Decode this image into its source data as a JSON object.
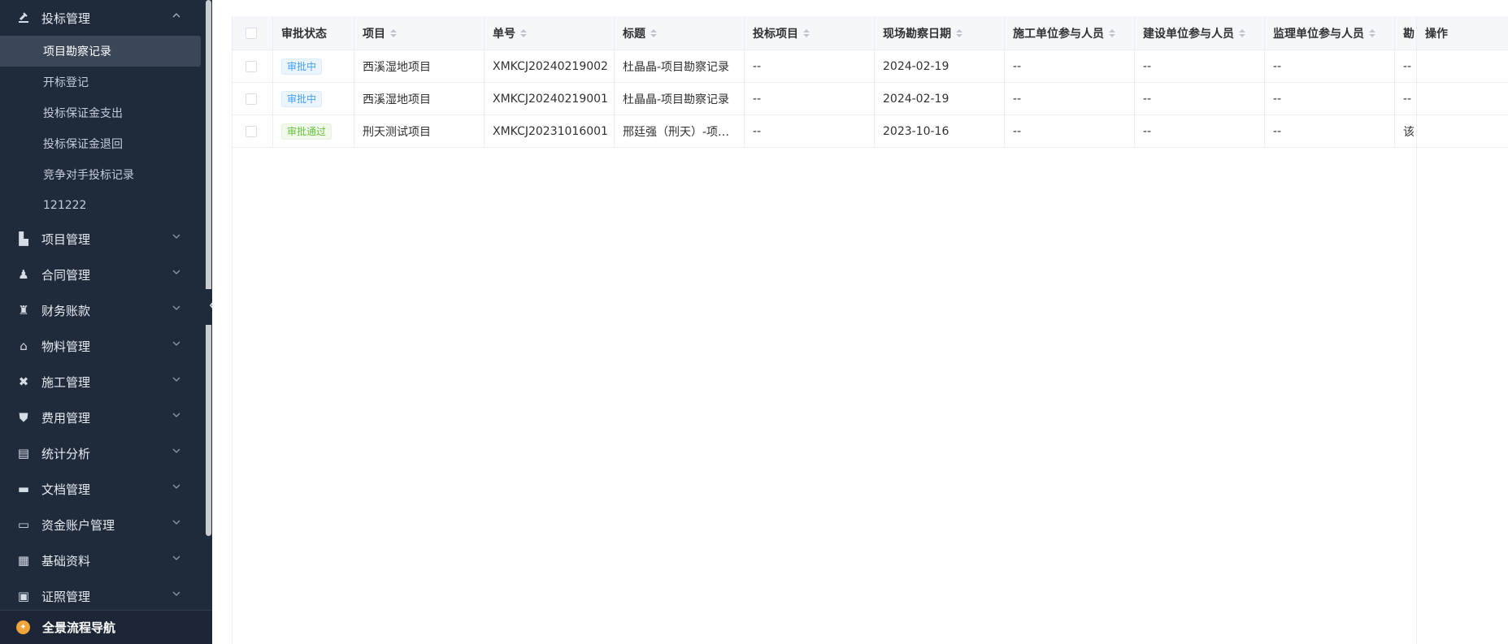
{
  "sidebar": {
    "open_group": {
      "label": "投标管理",
      "icon": "gavel-icon"
    },
    "submenu": [
      {
        "label": "项目勘察记录",
        "active": true
      },
      {
        "label": "开标登记",
        "active": false
      },
      {
        "label": "投标保证金支出",
        "active": false
      },
      {
        "label": "投标保证金退回",
        "active": false
      },
      {
        "label": "竞争对手投标记录",
        "active": false
      },
      {
        "label": "121222",
        "active": false
      }
    ],
    "groups": [
      {
        "label": "项目管理",
        "icon": "building-icon",
        "glyph": "▙"
      },
      {
        "label": "合同管理",
        "icon": "user-stamp-icon",
        "glyph": "♟"
      },
      {
        "label": "财务账款",
        "icon": "money-bag-icon",
        "glyph": "♜"
      },
      {
        "label": "物料管理",
        "icon": "warehouse-icon",
        "glyph": "⌂"
      },
      {
        "label": "施工管理",
        "icon": "tools-icon",
        "glyph": "✖"
      },
      {
        "label": "费用管理",
        "icon": "shield-icon",
        "glyph": "⛊"
      },
      {
        "label": "统计分析",
        "icon": "chart-icon",
        "glyph": "▤"
      },
      {
        "label": "文档管理",
        "icon": "folder-icon",
        "glyph": "▬"
      },
      {
        "label": "资金账户管理",
        "icon": "card-icon",
        "glyph": "▭"
      },
      {
        "label": "基础资料",
        "icon": "book-icon",
        "glyph": "▦"
      },
      {
        "label": "证照管理",
        "icon": "id-card-icon",
        "glyph": "▣"
      }
    ],
    "bottom": {
      "label": "全景流程导航",
      "icon": "compass-icon"
    }
  },
  "table": {
    "headers": [
      "审批状态",
      "项目",
      "单号",
      "标题",
      "投标项目",
      "现场勘察日期",
      "施工单位参与人员",
      "建设单位参与人员",
      "监理单位参与人员",
      "勘",
      "操作"
    ],
    "rows": [
      {
        "status": "审批中",
        "status_type": "pending",
        "project": "西溪湿地项目",
        "number": "XMKCJ20240219002",
        "title": "杜晶晶-项目勘察记录",
        "bid_project": "--",
        "date": "2024-02-19",
        "construction": "--",
        "builder": "--",
        "supervisor": "--",
        "extra": "--"
      },
      {
        "status": "审批中",
        "status_type": "pending",
        "project": "西溪湿地项目",
        "number": "XMKCJ20240219001",
        "title": "杜晶晶-项目勘察记录",
        "bid_project": "--",
        "date": "2024-02-19",
        "construction": "--",
        "builder": "--",
        "supervisor": "--",
        "extra": "--"
      },
      {
        "status": "审批通过",
        "status_type": "passed",
        "project": "刑天测试项目",
        "number": "XMKCJ20231016001",
        "title": "邢廷强（刑天）-项…",
        "bid_project": "--",
        "date": "2023-10-16",
        "construction": "--",
        "builder": "--",
        "supervisor": "--",
        "extra": "该"
      }
    ]
  }
}
